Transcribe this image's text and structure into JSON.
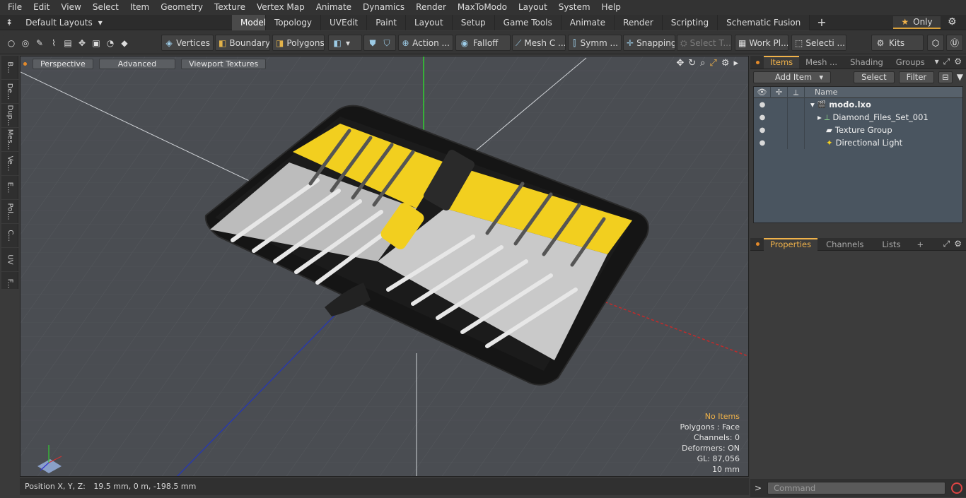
{
  "menu": [
    "File",
    "Edit",
    "View",
    "Select",
    "Item",
    "Geometry",
    "Texture",
    "Vertex Map",
    "Animate",
    "Dynamics",
    "Render",
    "MaxToModo",
    "Layout",
    "System",
    "Help"
  ],
  "layouts": {
    "label": "Default Layouts",
    "arrow": "▾"
  },
  "tabs": [
    "Model",
    "Topology",
    "UVEdit",
    "Paint",
    "Layout",
    "Setup",
    "Game Tools",
    "Animate",
    "Render",
    "Scripting",
    "Schematic Fusion"
  ],
  "active_tab": "Model",
  "add_tab": "+",
  "only": {
    "star": "★",
    "label": "Only"
  },
  "gear": "⚙",
  "toolbar": {
    "vertices": "Vertices",
    "boundary": "Boundary",
    "polygons": "Polygons",
    "action": "Action ...",
    "falloff": "Falloff",
    "mesh": "Mesh C ...",
    "symm": "Symm ...",
    "snapping": "Snapping",
    "select_t": "Select T...",
    "workpl": "Work Pl...",
    "selecti": "Selecti ...",
    "kits": "Kits"
  },
  "left_tabs": [
    "B...",
    "De...",
    "Dup...",
    "Mes...",
    "Ve...",
    "E...",
    "Pol...",
    "C...",
    "UV",
    "F..."
  ],
  "viewport": {
    "perspective": "Perspective",
    "advanced": "Advanced",
    "textures": "Viewport Textures"
  },
  "viewport_info": {
    "items": "No Items",
    "polygons": "Polygons : Face",
    "channels": "Channels: 0",
    "deformers": "Deformers: ON",
    "gl": "GL: 87,056",
    "scale": "10 mm"
  },
  "status": {
    "label": "Position X, Y, Z:",
    "value": "19.5 mm, 0 m, -198.5 mm"
  },
  "items_panel": {
    "tabs": [
      "Items",
      "Mesh ...",
      "Shading",
      "Groups"
    ],
    "add_item": "Add Item",
    "select": "Select",
    "filter": "Filter",
    "name_col": "Name",
    "rows": [
      {
        "name": "modo.lxo",
        "icon": "🎬"
      },
      {
        "name": "Diamond_Files_Set_001",
        "icon": "⟂"
      },
      {
        "name": "Texture Group",
        "icon": "▰"
      },
      {
        "name": "Directional Light",
        "icon": "✦"
      }
    ]
  },
  "props_panel": {
    "tabs": [
      "Properties",
      "Channels",
      "Lists"
    ],
    "add": "+"
  },
  "command": {
    "placeholder": "Command",
    "prompt": ">"
  },
  "colors": {
    "accent": "#f0b24a",
    "viewport_bg": "#4a4d52",
    "yellow": "#f2cf1f"
  }
}
